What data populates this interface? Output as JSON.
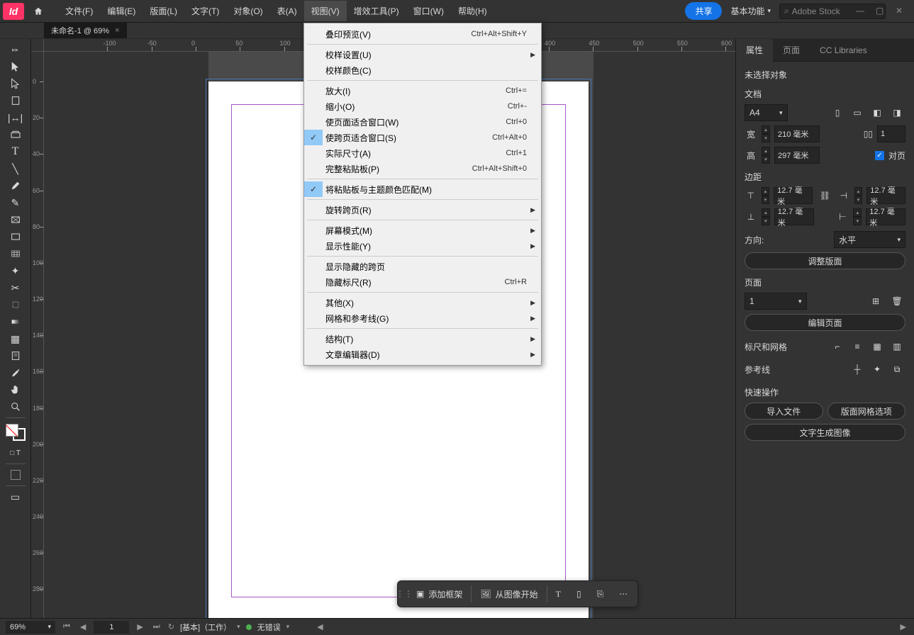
{
  "app": {
    "name": "Id"
  },
  "menu": {
    "file": "文件(F)",
    "edit": "编辑(E)",
    "layout": "版面(L)",
    "type": "文字(T)",
    "object": "对象(O)",
    "table": "表(A)",
    "view": "视图(V)",
    "plugins": "增效工具(P)",
    "window": "窗口(W)",
    "help": "帮助(H)"
  },
  "top": {
    "share": "共享",
    "workspace": "基本功能",
    "search_placeholder": "Adobe Stock"
  },
  "tab": {
    "title": "未命名-1 @ 69%"
  },
  "view_menu": {
    "overprint": {
      "label": "叠印预览(V)",
      "shortcut": "Ctrl+Alt+Shift+Y"
    },
    "proof_setup": {
      "label": "校样设置(U)"
    },
    "proof_colors": {
      "label": "校样颜色(C)"
    },
    "zoom_in": {
      "label": "放大(I)",
      "shortcut": "Ctrl+="
    },
    "zoom_out": {
      "label": "缩小(O)",
      "shortcut": "Ctrl+-"
    },
    "fit_page": {
      "label": "使页面适合窗口(W)",
      "shortcut": "Ctrl+0"
    },
    "fit_spread": {
      "label": "使跨页适合窗口(S)",
      "shortcut": "Ctrl+Alt+0"
    },
    "actual_size": {
      "label": "实际尺寸(A)",
      "shortcut": "Ctrl+1"
    },
    "entire_paste": {
      "label": "完整粘贴板(P)",
      "shortcut": "Ctrl+Alt+Shift+0"
    },
    "match_paste": {
      "label": "将粘贴板与主题颜色匹配(M)"
    },
    "rotate_spread": {
      "label": "旋转跨页(R)"
    },
    "screen_mode": {
      "label": "屏幕模式(M)"
    },
    "display_perf": {
      "label": "显示性能(Y)"
    },
    "show_hidden_spreads": {
      "label": "显示隐藏的跨页"
    },
    "hide_rulers": {
      "label": "隐藏标尺(R)",
      "shortcut": "Ctrl+R"
    },
    "extras": {
      "label": "其他(X)"
    },
    "grids_guides": {
      "label": "网格和参考线(G)"
    },
    "structure": {
      "label": "结构(T)"
    },
    "story_editor": {
      "label": "文章编辑器(D)"
    }
  },
  "panels": {
    "tabs": {
      "properties": "属性",
      "pages": "页面",
      "cc": "CC Libraries"
    },
    "no_selection": "未选择对象",
    "doc": {
      "title": "文档",
      "preset": "A4",
      "width_label": "宽",
      "width": "210 毫米",
      "height_label": "高",
      "height": "297 毫米",
      "spread_count": "1",
      "facing_label": "对页"
    },
    "margins": {
      "title": "边距",
      "top": "12.7 毫米",
      "bottom": "12.7 毫米",
      "left": "12.7 毫米",
      "right": "12.7 毫米"
    },
    "orientation": {
      "label": "方向:",
      "value": "水平"
    },
    "adjust_layout": "调整版面",
    "pages_sec": {
      "title": "页面",
      "current": "1",
      "edit": "编辑页面"
    },
    "rulers_grids": "标尺和网格",
    "guides": "参考线",
    "quick": {
      "title": "快速操作",
      "import": "导入文件",
      "grid_options": "版面网格选项",
      "text_to_image": "文字生成图像"
    }
  },
  "context": {
    "add_frame": "添加框架",
    "from_image": "从图像开始"
  },
  "status": {
    "zoom": "69%",
    "page": "1",
    "master": "[基本]（工作）",
    "errors": "无错误"
  }
}
